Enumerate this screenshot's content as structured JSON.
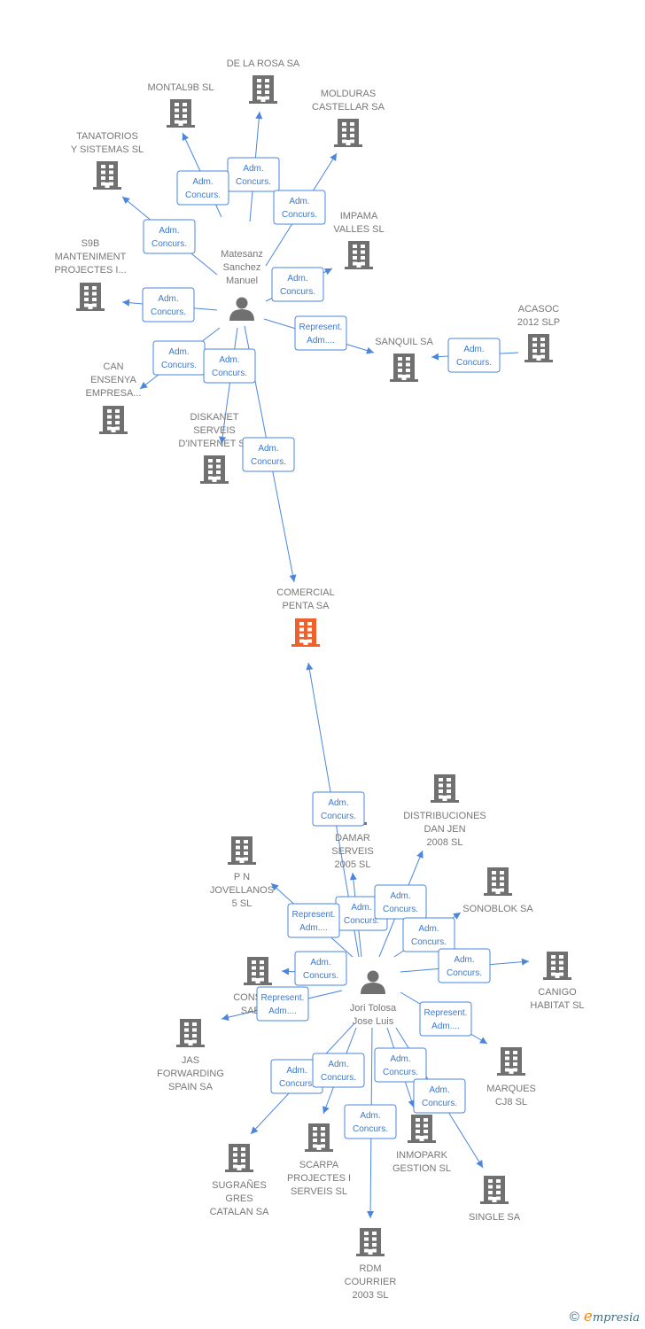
{
  "colors": {
    "node": "#707070",
    "focus": "#f0602a",
    "edge": "#4a86de",
    "label": "#777777"
  },
  "persons": [
    {
      "id": "matesanz",
      "lines": [
        "Matesanz",
        "Sanchez",
        "Manuel"
      ]
    },
    {
      "id": "jori",
      "lines": [
        "Jori Tolosa",
        "Jose Luis"
      ]
    }
  ],
  "companies": [
    {
      "id": "delarosa",
      "lines": [
        "DE LA ROSA SA"
      ]
    },
    {
      "id": "montal9b",
      "lines": [
        "MONTAL9B SL"
      ]
    },
    {
      "id": "molduras",
      "lines": [
        "MOLDURAS",
        "CASTELLAR SA"
      ]
    },
    {
      "id": "tanatorios",
      "lines": [
        "TANATORIOS",
        "Y SISTEMAS SL"
      ]
    },
    {
      "id": "impama",
      "lines": [
        "IMPAMA",
        "VALLES SL"
      ]
    },
    {
      "id": "s9b",
      "lines": [
        "S9B",
        "MANTENIMENT",
        "PROJECTES I..."
      ]
    },
    {
      "id": "acasoc",
      "lines": [
        "ACASOC",
        "2012 SLP"
      ]
    },
    {
      "id": "sanquil",
      "lines": [
        "SANQUIL SA"
      ]
    },
    {
      "id": "can",
      "lines": [
        "CAN",
        "ENSENYA",
        "EMPRESA..."
      ]
    },
    {
      "id": "diskanet",
      "lines": [
        "DISKANET",
        "SERVEIS",
        "D'INTERNET SL"
      ]
    },
    {
      "id": "comercial",
      "lines": [
        "COMERCIAL",
        "PENTA SA"
      ],
      "focus": true
    },
    {
      "id": "distribuciones",
      "lines": [
        "DISTRIBUCIONES",
        "DAN JEN",
        "2008 SL"
      ]
    },
    {
      "id": "damar",
      "lines": [
        "DAMAR",
        "SERVEIS",
        "2005 SL"
      ]
    },
    {
      "id": "pn",
      "lines": [
        "P N",
        "JOVELLANOS",
        "5 SL"
      ]
    },
    {
      "id": "sonoblok",
      "lines": [
        "SONOBLOK SA"
      ]
    },
    {
      "id": "canigo",
      "lines": [
        "CANIGO",
        "HABITAT SL"
      ]
    },
    {
      "id": "constr",
      "lines": [
        "CONSTR...",
        "SABE..."
      ]
    },
    {
      "id": "jas",
      "lines": [
        "JAS",
        "FORWARDING",
        "SPAIN SA"
      ]
    },
    {
      "id": "marques",
      "lines": [
        "MARQUES",
        "CJ8 SL"
      ]
    },
    {
      "id": "inmopark",
      "lines": [
        "INMOPARK",
        "GESTION SL"
      ]
    },
    {
      "id": "scarpa",
      "lines": [
        "SCARPA",
        "PROJECTES I",
        "SERVEIS SL"
      ]
    },
    {
      "id": "sugranes",
      "lines": [
        "SUGRAÑES",
        "GRES",
        "CATALAN SA"
      ]
    },
    {
      "id": "single",
      "lines": [
        "SINGLE SA"
      ]
    },
    {
      "id": "rdm",
      "lines": [
        "RDM",
        "COURRIER",
        "2003 SL"
      ]
    }
  ],
  "edges": [
    {
      "from": "matesanz",
      "to": "delarosa",
      "label": [
        "Adm.",
        "Concurs."
      ]
    },
    {
      "from": "matesanz",
      "to": "montal9b",
      "label": [
        "Adm.",
        "Concurs."
      ]
    },
    {
      "from": "matesanz",
      "to": "molduras",
      "label": [
        "Adm.",
        "Concurs."
      ]
    },
    {
      "from": "matesanz",
      "to": "tanatorios",
      "label": [
        "Adm.",
        "Concurs."
      ]
    },
    {
      "from": "matesanz",
      "to": "impama",
      "label": [
        "Adm.",
        "Concurs."
      ]
    },
    {
      "from": "matesanz",
      "to": "s9b",
      "label": [
        "Adm.",
        "Concurs."
      ]
    },
    {
      "from": "matesanz",
      "to": "sanquil",
      "label": [
        "Represent.",
        "Adm...."
      ]
    },
    {
      "from": "matesanz",
      "to": "can",
      "label": [
        "Adm.",
        "Concurs."
      ]
    },
    {
      "from": "matesanz",
      "to": "diskanet",
      "label": [
        "Adm.",
        "Concurs."
      ]
    },
    {
      "from": "matesanz",
      "to": "comercial",
      "label": [
        "Adm.",
        "Concurs."
      ]
    },
    {
      "from": "acasoc",
      "to": "sanquil",
      "label": [
        "Adm.",
        "Concurs."
      ]
    },
    {
      "from": "jori",
      "to": "comercial",
      "label": [
        "Adm.",
        "Concurs."
      ]
    },
    {
      "from": "jori",
      "to": "damar",
      "label": [
        "Adm.",
        "Concurs."
      ]
    },
    {
      "from": "jori",
      "to": "distribuciones",
      "label": [
        "Adm.",
        "Concurs."
      ]
    },
    {
      "from": "jori",
      "to": "pn",
      "label": [
        "Represent.",
        "Adm...."
      ]
    },
    {
      "from": "jori",
      "to": "sonoblok",
      "label": [
        "Adm.",
        "Concurs."
      ]
    },
    {
      "from": "jori",
      "to": "canigo",
      "label": [
        "Adm.",
        "Concurs."
      ]
    },
    {
      "from": "jori",
      "to": "constr",
      "label": [
        "Adm.",
        "Concurs."
      ]
    },
    {
      "from": "jori",
      "to": "jas",
      "label": [
        "Represent.",
        "Adm...."
      ]
    },
    {
      "from": "jori",
      "to": "marques",
      "label": [
        "Represent.",
        "Adm...."
      ]
    },
    {
      "from": "jori",
      "to": "sugranes",
      "label": [
        "Adm.",
        "Concurs."
      ]
    },
    {
      "from": "jori",
      "to": "scarpa",
      "label": [
        "Adm.",
        "Concurs."
      ]
    },
    {
      "from": "jori",
      "to": "rdm",
      "label": [
        "Adm.",
        "Concurs."
      ]
    },
    {
      "from": "jori",
      "to": "inmopark",
      "label": [
        "Adm.",
        "Concurs."
      ]
    },
    {
      "from": "jori",
      "to": "single",
      "label": [
        "Adm.",
        "Concurs."
      ]
    }
  ],
  "footer": {
    "copyright": "©",
    "brand_initial": "e",
    "brand_rest": "mpresia"
  }
}
